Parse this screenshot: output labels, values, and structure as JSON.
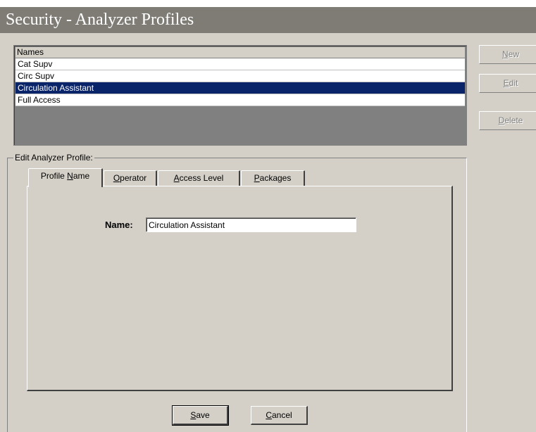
{
  "window": {
    "title": "Security - Analyzer Profiles"
  },
  "names_list": {
    "header": "Names",
    "items": [
      "Cat Supv",
      "Circ Supv",
      "Circulation Assistant",
      "Full Access"
    ],
    "selected": "Circulation Assistant"
  },
  "side_buttons": {
    "new": {
      "u": "N",
      "rest": "ew"
    },
    "edit": {
      "u": "E",
      "rest": "dit"
    },
    "delete": {
      "u": "D",
      "rest": "elete"
    }
  },
  "edit_group": {
    "label": "Edit  Analyzer Profile:",
    "tabs": [
      {
        "pre": "Profile ",
        "u": "N",
        "rest": "ame"
      },
      {
        "pre": "",
        "u": "O",
        "rest": "perator"
      },
      {
        "pre": "",
        "u": "A",
        "rest": "ccess Level"
      },
      {
        "pre": "",
        "u": "P",
        "rest": "ackages"
      }
    ],
    "name_label": "Name:",
    "name_value": "Circulation Assistant"
  },
  "footer": {
    "save": {
      "u": "S",
      "rest": "ave"
    },
    "cancel": {
      "u": "C",
      "rest": "ancel"
    }
  },
  "colors": {
    "face": "#d4d0c8",
    "title_bg": "#7f7c75",
    "selection": "#0a246a"
  }
}
